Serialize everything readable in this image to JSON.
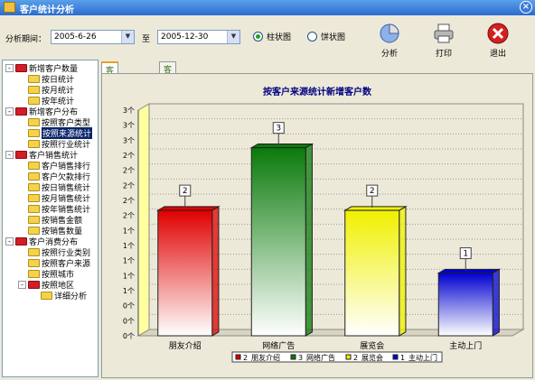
{
  "window": {
    "title": "客户统计分析"
  },
  "toolbar": {
    "period_label": "分析期间：",
    "start_date": "2005-6-26",
    "to_label": "至",
    "end_date": "2005-12-30",
    "radio_bar": "柱状图",
    "radio_pie": "饼状图",
    "selected": "柱状图",
    "btn_analyze": "分析",
    "btn_print": "打印",
    "btn_exit": "退出"
  },
  "tree": [
    {
      "label": "新增客户数量",
      "level": 0,
      "type": "group",
      "expander": "-"
    },
    {
      "label": "按日统计",
      "level": 1,
      "type": "leaf"
    },
    {
      "label": "按月统计",
      "level": 1,
      "type": "leaf"
    },
    {
      "label": "按年统计",
      "level": 1,
      "type": "leaf"
    },
    {
      "label": "新增客户分布",
      "level": 0,
      "type": "group",
      "expander": "-"
    },
    {
      "label": "按照客户类型",
      "level": 1,
      "type": "leaf"
    },
    {
      "label": "按照来源统计",
      "level": 1,
      "type": "leaf",
      "selected": true
    },
    {
      "label": "按照行业统计",
      "level": 1,
      "type": "leaf"
    },
    {
      "label": "客户销售统计",
      "level": 0,
      "type": "group",
      "expander": "-"
    },
    {
      "label": "客户销售排行",
      "level": 1,
      "type": "leaf"
    },
    {
      "label": "客户欠款排行",
      "level": 1,
      "type": "leaf"
    },
    {
      "label": "按日销售统计",
      "level": 1,
      "type": "leaf"
    },
    {
      "label": "按月销售统计",
      "level": 1,
      "type": "leaf"
    },
    {
      "label": "按年销售统计",
      "level": 1,
      "type": "leaf"
    },
    {
      "label": "按销售金额",
      "level": 1,
      "type": "leaf"
    },
    {
      "label": "按销售数量",
      "level": 1,
      "type": "leaf"
    },
    {
      "label": "客户消费分布",
      "level": 0,
      "type": "group",
      "expander": "-"
    },
    {
      "label": "按照行业类别",
      "level": 1,
      "type": "leaf"
    },
    {
      "label": "按照客户来源",
      "level": 1,
      "type": "leaf"
    },
    {
      "label": "按照城市",
      "level": 1,
      "type": "leaf"
    },
    {
      "label": "按照地区",
      "level": 1,
      "type": "group",
      "expander": "-"
    },
    {
      "label": "详细分析",
      "level": 2,
      "type": "leaf"
    }
  ],
  "tabs": [
    {
      "label": "客户分析图表",
      "active": true
    },
    {
      "label": "客户分析列表",
      "active": false
    }
  ],
  "chart_data": {
    "type": "bar",
    "title": "按客户来源统计新增客户数",
    "categories": [
      "朋友介绍",
      "网络广告",
      "展览会",
      "主动上门"
    ],
    "values": [
      2,
      3,
      2,
      1
    ],
    "data_labels": [
      "2",
      "3",
      "2",
      "1"
    ],
    "colors": [
      "#e00000",
      "#0a7a0a",
      "#f0f000",
      "#0000d0"
    ],
    "yticks": [
      "0个",
      "0个",
      "0个",
      "1个",
      "1个",
      "1个",
      "1个",
      "1个",
      "2个",
      "2个",
      "2个",
      "2个",
      "2个",
      "3个",
      "3个",
      "3个"
    ],
    "ylim": [
      0,
      3.6
    ],
    "grid": true,
    "legend": [
      {
        "num": "2",
        "name": "朋友介绍"
      },
      {
        "num": "3",
        "name": "网络广告"
      },
      {
        "num": "2",
        "name": "展览会"
      },
      {
        "num": "1",
        "name": "主动上门"
      }
    ],
    "legend_placement": "bottom"
  }
}
